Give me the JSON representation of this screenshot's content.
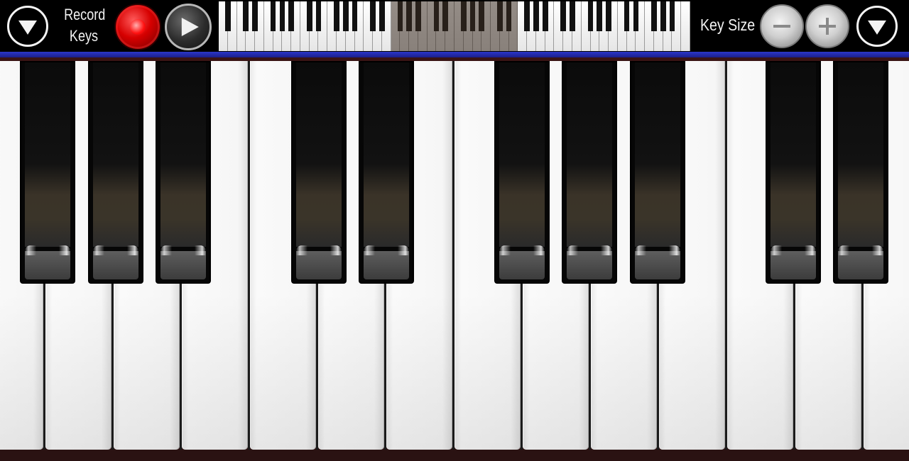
{
  "toolbar": {
    "record_label_line1": "Record",
    "record_label_line2": "Keys",
    "key_size_label": "Key Size",
    "icons": {
      "menu_left": "chevron-down-icon",
      "record": "record-icon",
      "play": "play-icon",
      "minus": "minus-icon",
      "plus": "plus-icon",
      "menu_right": "chevron-down-icon"
    }
  },
  "colors": {
    "accent_blue": "#2c36c9",
    "record_red": "#d60000",
    "background": "#000000"
  }
}
